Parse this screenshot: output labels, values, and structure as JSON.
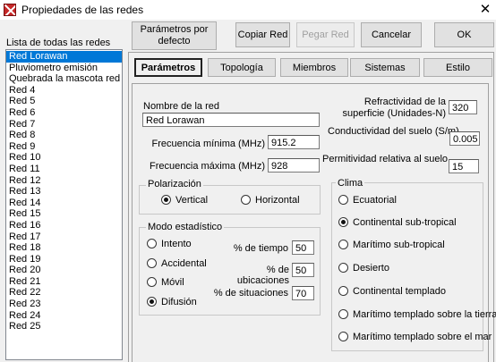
{
  "window": {
    "title": "Propiedades de las redes",
    "close": "✕"
  },
  "toolbar": {
    "defaults_label": "Parámetros por defecto",
    "copy_label": "Copiar Red",
    "paste_label": "Pegar Red",
    "cancel_label": "Cancelar",
    "ok_label": "OK"
  },
  "networks": {
    "label": "Lista de todas las redes",
    "items": [
      "Red Lorawan",
      "Pluviometro emisión",
      "Quebrada la mascota red",
      "Red  4",
      "Red  5",
      "Red  6",
      "Red  7",
      "Red  8",
      "Red  9",
      "Red 10",
      "Red 11",
      "Red 12",
      "Red 13",
      "Red 14",
      "Red 15",
      "Red 16",
      "Red 17",
      "Red 18",
      "Red 19",
      "Red 20",
      "Red 21",
      "Red 22",
      "Red 23",
      "Red 24",
      "Red 25"
    ],
    "selected": "Red Lorawan"
  },
  "tabs": [
    "Parámetros",
    "Topología",
    "Miembros",
    "Sistemas",
    "Estilo"
  ],
  "active_tab": "Parámetros",
  "params": {
    "name_label": "Nombre de la red",
    "name_value": "Red Lorawan",
    "freq_min_label": "Frecuencia mínima (MHz)",
    "freq_min_value": "915.2",
    "freq_max_label": "Frecuencia máxima (MHz)",
    "freq_max_value": "928",
    "refractivity_label": "Refractividad de la superficie (Unidades-N)",
    "refractivity_value": "320",
    "conductivity_label": "Conductividad del suelo (S/m)",
    "conductivity_value": "0.005",
    "permittivity_label": "Permitividad relativa al suelo",
    "permittivity_value": "15"
  },
  "polarization": {
    "legend": "Polarización",
    "options": [
      "Vertical",
      "Horizontal"
    ],
    "selected": "Vertical"
  },
  "stat_mode": {
    "legend": "Modo estadístico",
    "options": [
      "Intento",
      "Accidental",
      "Móvil",
      "Difusión"
    ],
    "selected": "Difusión",
    "time_label": "% de tiempo",
    "time_value": "50",
    "locations_label": "% de ubicaciones",
    "locations_value": "50",
    "situations_label": "% de situaciones",
    "situations_value": "70"
  },
  "climate": {
    "legend": "Clima",
    "options": [
      "Ecuatorial",
      "Continental sub-tropical",
      "Marítimo sub-tropical",
      "Desierto",
      "Continental templado",
      "Marítimo templado sobre la tierra",
      "Marítimo templado sobre el mar"
    ],
    "selected": "Continental sub-tropical"
  }
}
